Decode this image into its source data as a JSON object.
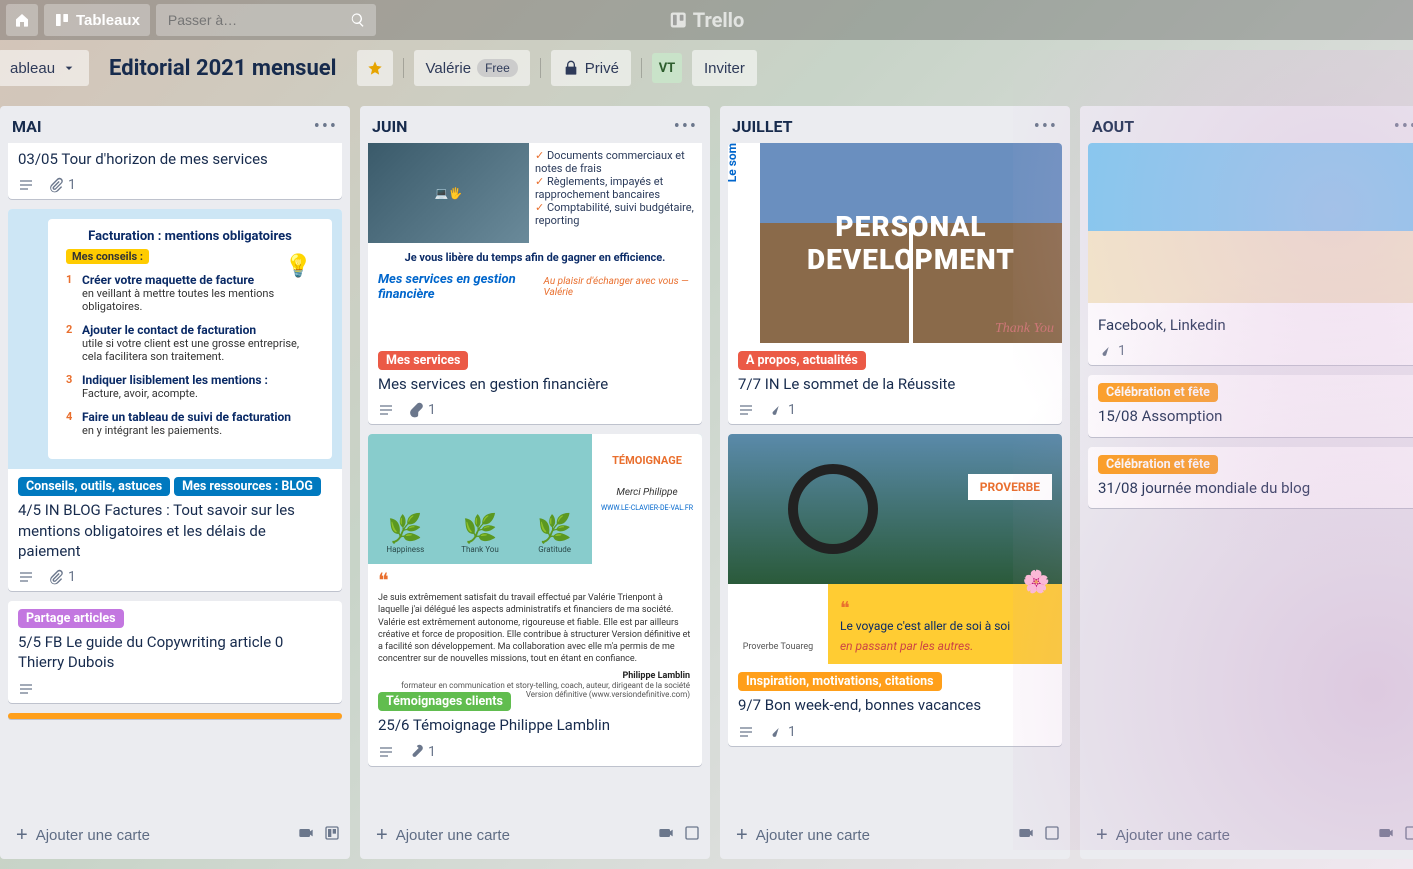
{
  "header": {
    "boards_label": "Tableaux",
    "search_placeholder": "Passer à…",
    "brand": "Trello"
  },
  "board": {
    "dropdown_label": "ableau",
    "title": "Editorial 2021 mensuel",
    "owner": "Valérie",
    "plan": "Free",
    "visibility": "Privé",
    "avatar_initials": "VT",
    "invite_label": "Inviter"
  },
  "lists": [
    {
      "title": "MAI",
      "add_label": "Ajouter une carte",
      "cards": [
        {
          "title": "03/05 Tour d'horizon de mes services",
          "attachments": "1",
          "partial": true
        },
        {
          "cover": "mai-facturation",
          "labels": [
            {
              "text": "Conseils, outils, astuces",
              "color": "blue"
            },
            {
              "text": "Mes ressources : BLOG",
              "color": "blue"
            }
          ],
          "title": "4/5 IN BLOG Factures : Tout savoir sur les mentions obligatoires et les délais de paiement",
          "attachments": "1"
        },
        {
          "labels": [
            {
              "text": "Partage articles",
              "color": "purple"
            }
          ],
          "title": "5/5 FB Le guide du Copywriting article 0 Thierry Dubois"
        }
      ],
      "cover_mai": {
        "sidebar": "Conseils, outils, astuces",
        "heading": "Facturation : mentions obligatoires",
        "tag": "Mes conseils :",
        "items": [
          {
            "n": "1",
            "b": "Créer votre maquette de facture",
            "t": "en veillant à mettre toutes les mentions obligatoires."
          },
          {
            "n": "2",
            "b": "Ajouter le contact de facturation",
            "t": "utile si votre client est une grosse entreprise, cela facilitera son traitement."
          },
          {
            "n": "3",
            "b": "Indiquer lisiblement les mentions :",
            "t": "Facture, avoir, acompte."
          },
          {
            "n": "4",
            "b": "Faire un tableau de suivi de facturation",
            "t": "en y intégrant les paiements."
          }
        ]
      }
    },
    {
      "title": "JUIN",
      "add_label": "Ajouter une carte",
      "cards": [
        {
          "cover": "juin-services",
          "labels": [
            {
              "text": "Mes services",
              "color": "red"
            }
          ],
          "title": "Mes services en gestion financière",
          "attachments": "1"
        },
        {
          "cover": "juin-temoin",
          "labels": [
            {
              "text": "Témoignages clients",
              "color": "green"
            }
          ],
          "title": "25/6 Témoignage Philippe Lamblin",
          "attachments": "1"
        }
      ],
      "cover_services": {
        "checks": [
          "Documents commerciaux et notes de frais",
          "Règlements, impayés et rapprochement bancaires",
          "Comptabilité, suivi budgétaire, reporting"
        ],
        "mid": "Je vous libère du temps afin de gagner en efficience.",
        "left": "Mes services en gestion financière",
        "right": "Au plaisir d'échanger avec vous — Valérie"
      },
      "cover_temoin": {
        "tside_title": "TÉMOIGNAGE",
        "tside_sig": "Merci Philippe",
        "tside_url": "WWW.LE-CLAVIER-DE-VAL.FR",
        "plants": [
          "Happiness",
          "Thank You",
          "Gratitude"
        ],
        "body": "Je suis extrêmement satisfait du travail effectué par Valérie Trienpont à laquelle j'ai délégué les aspects administratifs et financiers de ma société. Valérie est extrêmement autonome, rigoureuse et fiable. Elle est par ailleurs créative et force de proposition. Elle contribue à structurer Version définitive et a facilité son développement. Ma collaboration avec elle m'a permis de me concentrer sur de nouvelles missions, tout en étant en confiance.",
        "sig_name": "Philippe Lamblin",
        "sig_role": "formateur en communication et story-telling, coach, auteur, dirigeant de la société Version définitive (www.versiondefinitive.com)"
      }
    },
    {
      "title": "JUILLET",
      "add_label": "Ajouter une carte",
      "cards": [
        {
          "cover": "juil-dev",
          "labels": [
            {
              "text": "A propos, actualités",
              "color": "red"
            }
          ],
          "title": "7/7 IN Le sommet de la Réussite",
          "attachments": "1"
        },
        {
          "cover": "juil-proverb",
          "labels": [
            {
              "text": "Inspiration, motivations, citations",
              "color": "orange"
            }
          ],
          "title": "9/7 Bon week-end, bonnes vacances",
          "attachments": "1"
        }
      ],
      "cover_dev": {
        "sidebar": "Le sommet de la réussite",
        "big1": "PERSONAL",
        "big2": "DEVELOPMENT",
        "thank": "Thank You"
      },
      "cover_proverb": {
        "tag": "PROVERBE",
        "left": "Proverbe Touareg",
        "line1": "Le voyage c'est aller de soi à soi",
        "line2": "en passant par les autres."
      }
    },
    {
      "title": "AOUT",
      "add_label": "Ajouter une carte",
      "cards": [
        {
          "cover": "aout-beach",
          "title": "Facebook, Linkedin",
          "attachments": "1"
        },
        {
          "labels": [
            {
              "text": "Célébration et fête",
              "color": "orange"
            }
          ],
          "title": "15/08 Assomption"
        },
        {
          "labels": [
            {
              "text": "Célébration et fête",
              "color": "orange"
            }
          ],
          "title": "31/08 journée mondiale du blog"
        }
      ]
    }
  ]
}
